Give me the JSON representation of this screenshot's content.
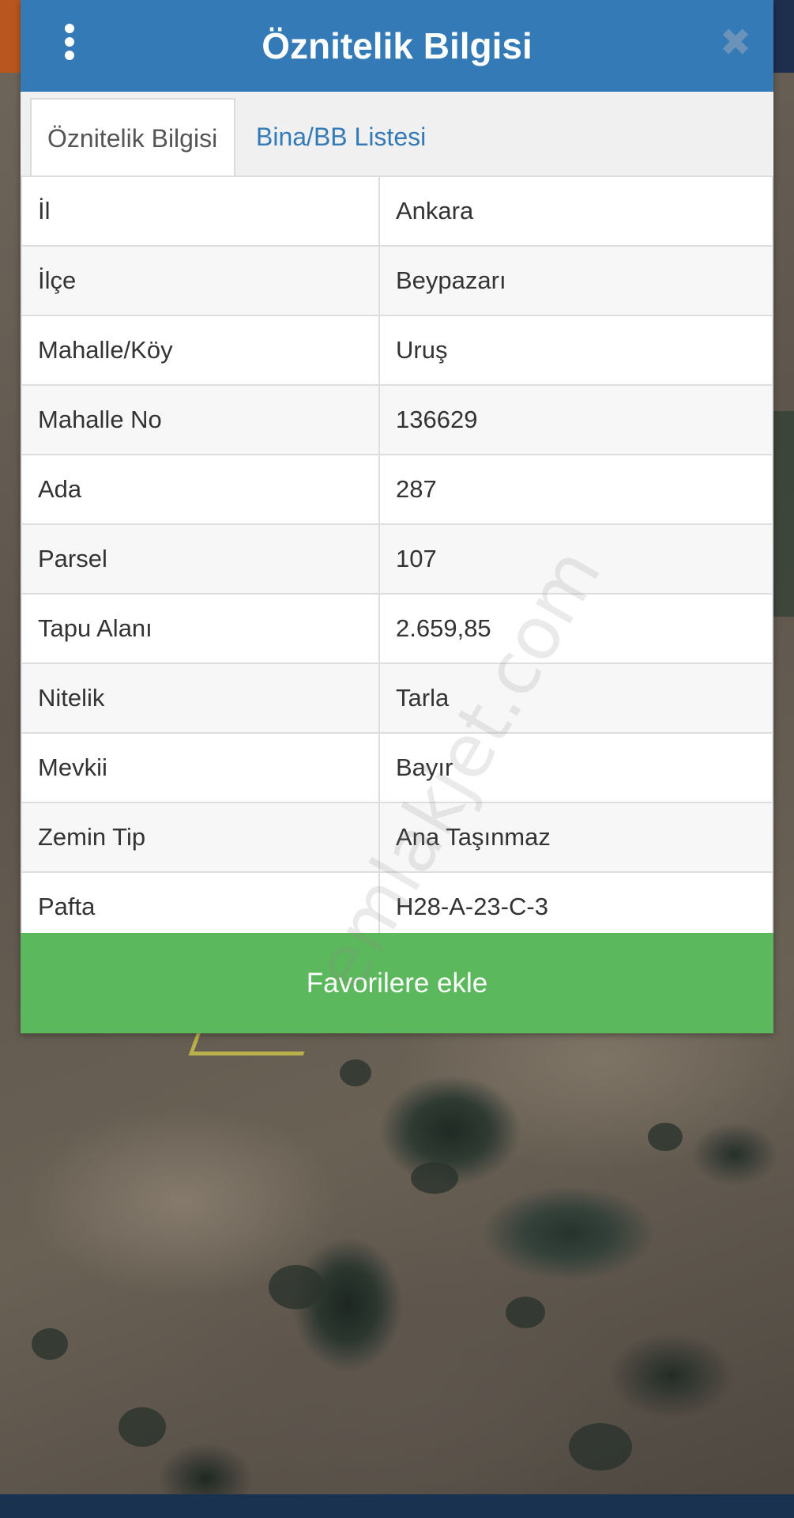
{
  "dialog": {
    "title": "Öznitelik Bilgisi",
    "close_glyph": "✖",
    "menu_icon": "vertical-dots-icon"
  },
  "tabs": [
    {
      "label": "Öznitelik Bilgisi",
      "active": true
    },
    {
      "label": "Bina/BB Listesi",
      "active": false
    }
  ],
  "attributes": [
    {
      "label": "İl",
      "value": "Ankara"
    },
    {
      "label": "İlçe",
      "value": "Beypazarı"
    },
    {
      "label": "Mahalle/Köy",
      "value": "Uruş"
    },
    {
      "label": "Mahalle No",
      "value": "136629"
    },
    {
      "label": "Ada",
      "value": "287"
    },
    {
      "label": "Parsel",
      "value": "107"
    },
    {
      "label": "Tapu Alanı",
      "value": "2.659,85"
    },
    {
      "label": "Nitelik",
      "value": "Tarla"
    },
    {
      "label": "Mevkii",
      "value": "Bayır"
    },
    {
      "label": "Zemin Tip",
      "value": "Ana Taşınmaz"
    },
    {
      "label": "Pafta",
      "value": "H28-A-23-C-3"
    }
  ],
  "favorite_button": {
    "label": "Favorilere ekle"
  },
  "watermark": "emlakjet.com",
  "colors": {
    "header": "#337ab7",
    "button": "#5cb85c",
    "tab_active_text": "#555555",
    "tab_inactive_text": "#337ab7"
  }
}
